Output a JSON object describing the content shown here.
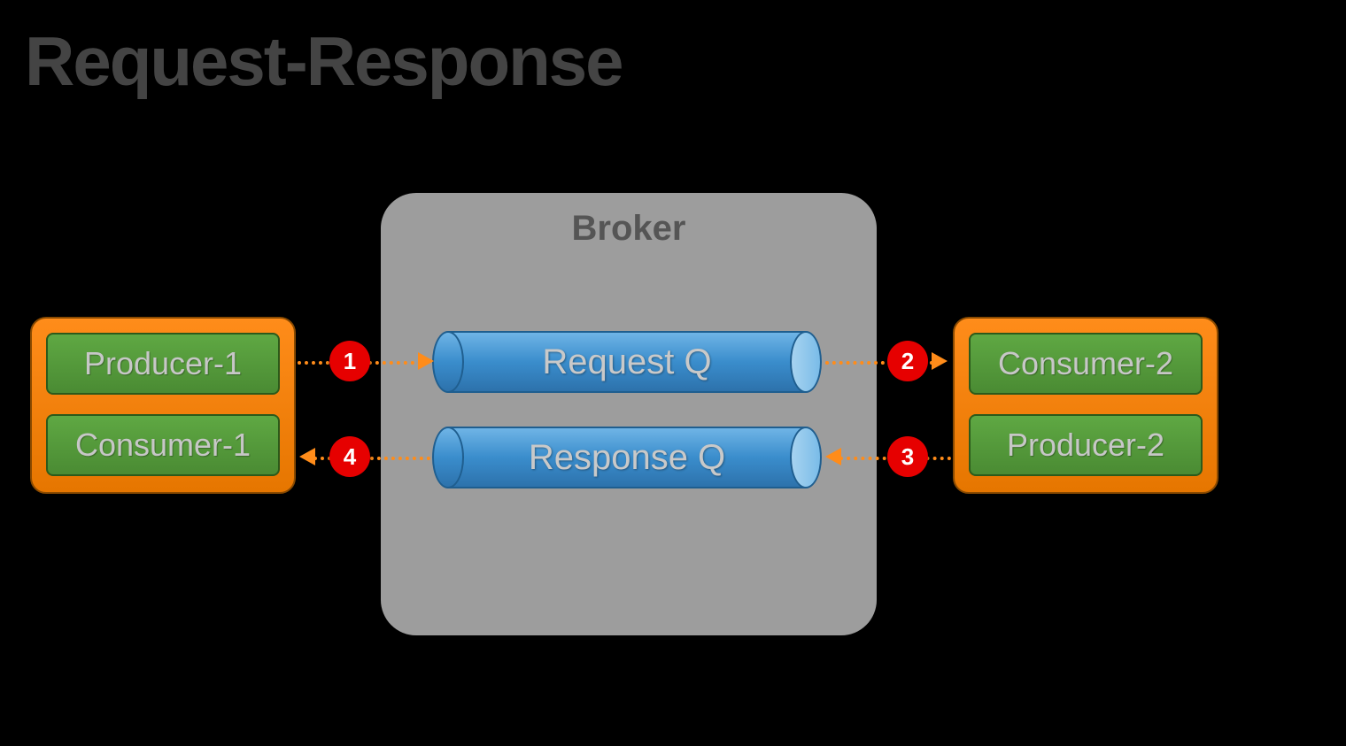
{
  "title": "Request-Response",
  "broker": {
    "label": "Broker"
  },
  "queues": {
    "request": "Request Q",
    "response": "Response Q"
  },
  "left_client": {
    "top": "Producer-1",
    "bottom": "Consumer-1"
  },
  "right_client": {
    "top": "Consumer-2",
    "bottom": "Producer-2"
  },
  "steps": {
    "s1": "1",
    "s2": "2",
    "s3": "3",
    "s4": "4"
  }
}
